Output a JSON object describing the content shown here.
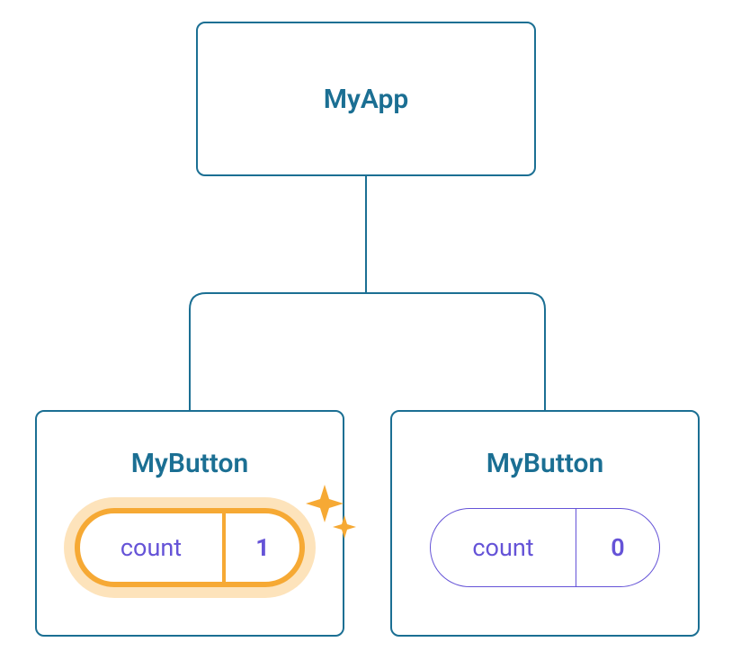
{
  "root": {
    "label": "MyApp"
  },
  "children": [
    {
      "label": "MyButton",
      "state_name": "count",
      "state_value": "1",
      "highlighted": true
    },
    {
      "label": "MyButton",
      "state_name": "count",
      "state_value": "0",
      "highlighted": false
    }
  ],
  "colors": {
    "node_border": "#1b6f93",
    "node_text": "#1b6f93",
    "pill_accent": "#6553d7",
    "highlight": "#f6a934"
  }
}
